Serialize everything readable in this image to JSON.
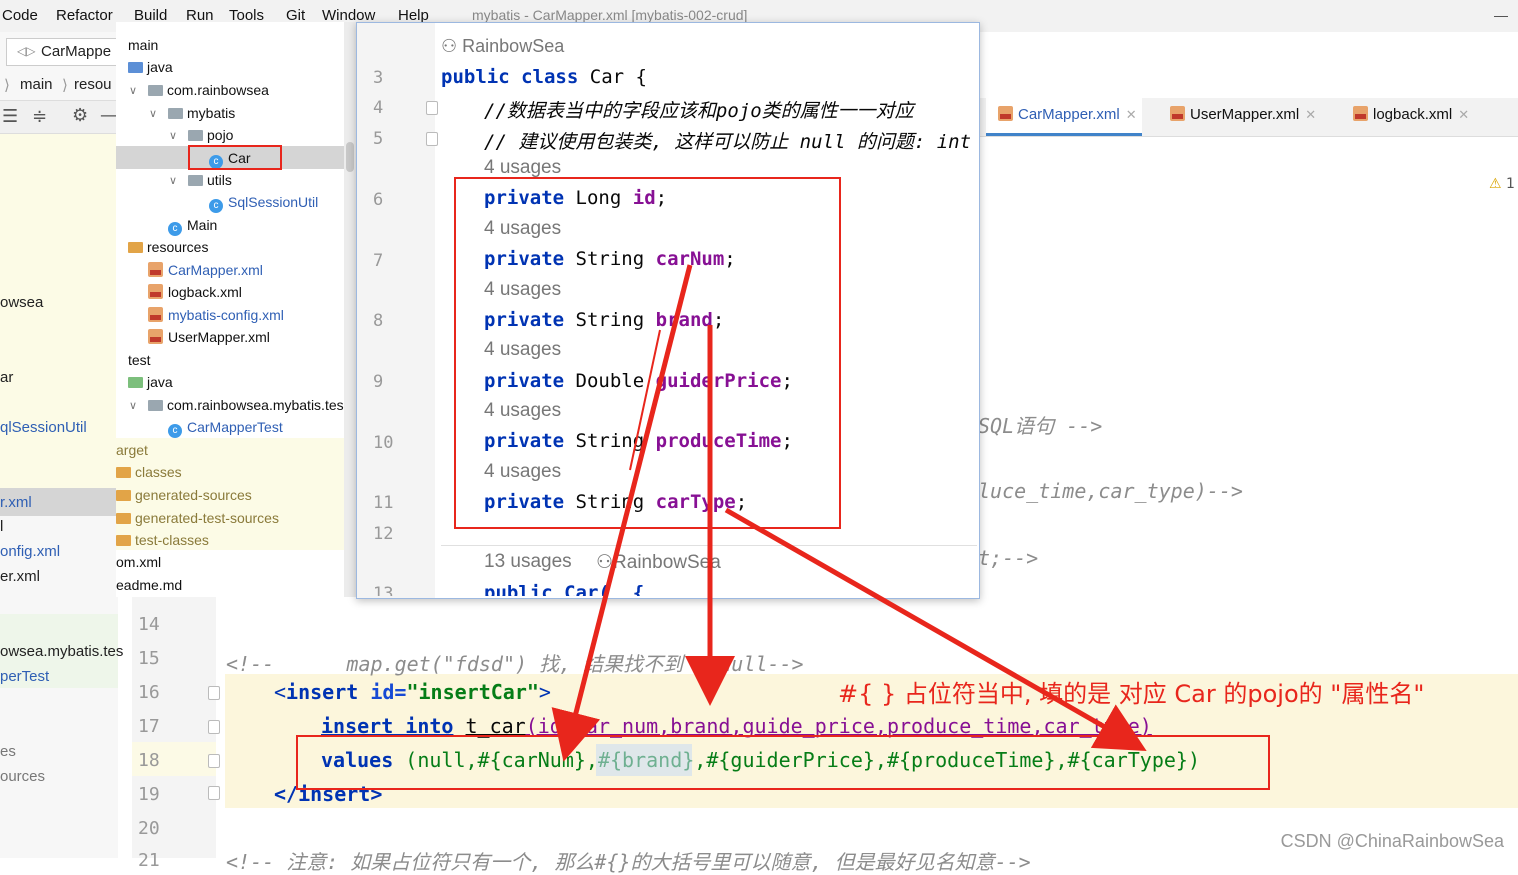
{
  "menu": {
    "items": [
      "Code",
      "Refactor",
      "Build",
      "Run",
      "Tools",
      "Git",
      "Window",
      "Help"
    ],
    "title": "mybatis - CarMapper.xml [mybatis-002-crud]"
  },
  "toolbar": {
    "run_config": "CarMappe"
  },
  "breadcrumb": {
    "main": "main",
    "resources": "resou"
  },
  "left_panel": {
    "items": [
      "owsea",
      "ar",
      "qlSessionUtil",
      "r.xml",
      "l",
      "onfig.xml",
      "er.xml",
      "owsea.mybatis.tes",
      "perTest",
      "es",
      "ources"
    ]
  },
  "project_tree": {
    "items": [
      {
        "label": "main"
      },
      {
        "label": "java"
      },
      {
        "label": "com.rainbowsea"
      },
      {
        "label": "mybatis"
      },
      {
        "label": "pojo"
      },
      {
        "label": "Car"
      },
      {
        "label": "utils"
      },
      {
        "label": "SqlSessionUtil"
      },
      {
        "label": "Main"
      },
      {
        "label": "resources"
      },
      {
        "label": "CarMapper.xml"
      },
      {
        "label": "logback.xml"
      },
      {
        "label": "mybatis-config.xml"
      },
      {
        "label": "UserMapper.xml"
      },
      {
        "label": "test"
      },
      {
        "label": "java"
      },
      {
        "label": "com.rainbowsea.mybatis.tes"
      },
      {
        "label": "CarMapperTest"
      },
      {
        "label": "arget"
      },
      {
        "label": "classes"
      },
      {
        "label": "generated-sources"
      },
      {
        "label": "generated-test-sources"
      },
      {
        "label": "test-classes"
      },
      {
        "label": "om.xml"
      },
      {
        "label": "eadme.md"
      }
    ]
  },
  "preview": {
    "author_header": "RainbowSea",
    "line_numbers": [
      "3",
      "4",
      "5",
      "6",
      "7",
      "8",
      "9",
      "10",
      "11",
      "12",
      "13"
    ],
    "class_decl": {
      "kw1": "public",
      "kw2": "class",
      "name": "Car",
      "brace": "{"
    },
    "comment1": "//数据表当中的字段应该和pojo类的属性一一对应",
    "comment2": "// 建议使用包装类, 这样可以防止 null 的问题: int",
    "usage_label": "4 usages",
    "fields": [
      {
        "kw": "private",
        "type": "Long",
        "name": "id"
      },
      {
        "kw": "private",
        "type": "String",
        "name": "carNum"
      },
      {
        "kw": "private",
        "type": "String",
        "name": "brand"
      },
      {
        "kw": "private",
        "type": "Double",
        "name": "guiderPrice"
      },
      {
        "kw": "private",
        "type": "String",
        "name": "produceTime"
      },
      {
        "kw": "private",
        "type": "String",
        "name": "carType"
      }
    ],
    "ctor_usages": "13 usages",
    "ctor_author": "RainbowSea",
    "ctor_partial": "public Car(  {"
  },
  "tabs": [
    {
      "label": "CarMapper.xml",
      "active": true
    },
    {
      "label": "UserMapper.xml",
      "active": false
    },
    {
      "label": "logback.xml",
      "active": false
    }
  ],
  "warning_badge": "1",
  "editor": {
    "line_numbers": [
      "14",
      "15",
      "16",
      "17",
      "18",
      "19",
      "20",
      "21"
    ],
    "frag1": "SQL语句 -->",
    "frag2": "luce_time,car_type)-->",
    "frag3": "t;-->",
    "line15": "<!--      map.get(\"fdsd\") 找, 结果找不到 = null-->",
    "insert_open": {
      "lt": "<",
      "tag": "insert",
      "attr": "id=",
      "val": "\"insertCar\"",
      "gt": ">"
    },
    "line17": {
      "kw": "insert into",
      "table": "t_car",
      "cols": "(id,car_num,brand,guide_price,produce_time,car_type)"
    },
    "line18": {
      "kw": "values",
      "vals": "(null,#{carNum},#{brand},#{guiderPrice},#{produceTime},#{carType})"
    },
    "insert_close": "</insert>",
    "line21": "<!-- 注意: 如果占位符只有一个, 那么#{}的大括号里可以随意, 但是最好见名知意-->"
  },
  "annotation": "#{ } 占位符当中, 填的是 对应 Car 的pojo的 \"属性名\"",
  "watermark": "CSDN @ChinaRainbowSea",
  "colors": {
    "annotation_red": "#e8261c",
    "keyword_blue": "#0033b3",
    "field_purple": "#871094",
    "string_green": "#067d17"
  }
}
